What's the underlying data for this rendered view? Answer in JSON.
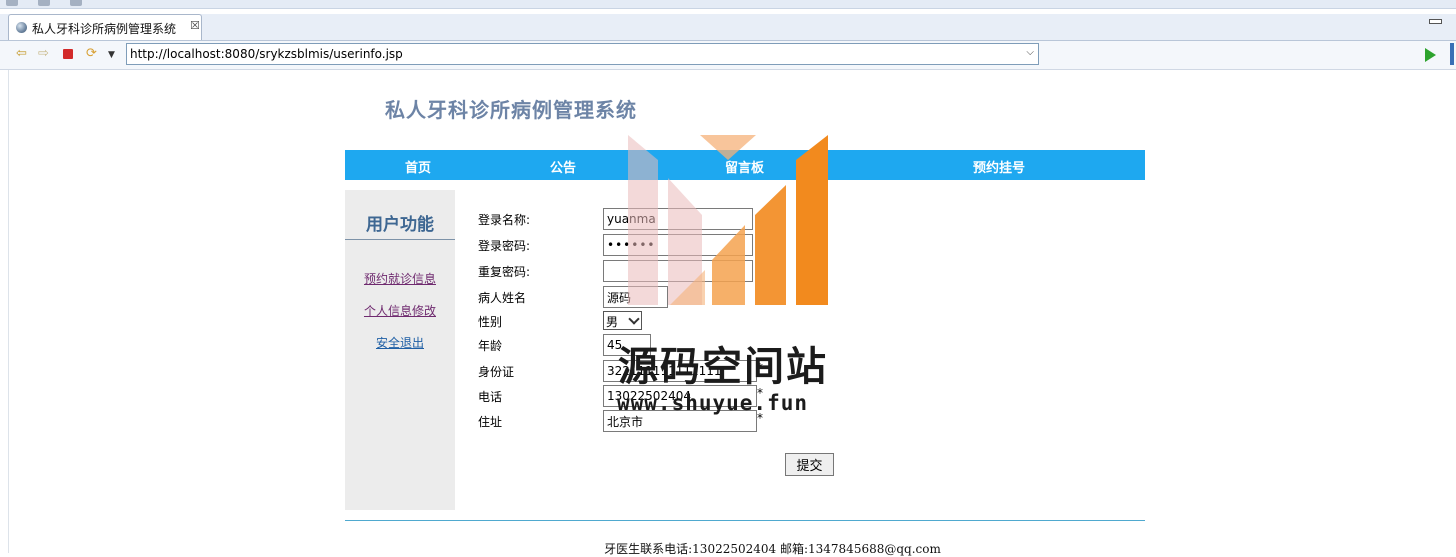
{
  "browser": {
    "tab_title": "私人牙科诊所病例管理系统",
    "tab_close": "☒",
    "url": "http://localhost:8080/srykzsblmis/userinfo.jsp"
  },
  "site": {
    "title": "私人牙科诊所病例管理系统",
    "nav": [
      "首页",
      "公告",
      "留言板",
      "预约挂号"
    ]
  },
  "sidebar": {
    "heading": "用户功能",
    "links": [
      "预约就诊信息",
      "个人信息修改",
      "安全退出"
    ]
  },
  "form": {
    "fields": [
      {
        "label": "登录名称:",
        "value": "yuanma"
      },
      {
        "label": "登录密码:",
        "value": "••••••"
      },
      {
        "label": "重复密码:",
        "value": ""
      },
      {
        "label": "病人姓名",
        "value": "源码"
      },
      {
        "label": "性别",
        "value": "男"
      },
      {
        "label": "年龄",
        "value": "45"
      },
      {
        "label": "身份证",
        "value": "322111111111111",
        "required": "*"
      },
      {
        "label": "电话",
        "value": "13022502404",
        "required": "*"
      },
      {
        "label": "住址",
        "value": "北京市",
        "required": "*"
      }
    ],
    "submit_label": "提交"
  },
  "footer": {
    "text": "牙医生联系电话:13022502404 邮箱:1347845688@qq.com"
  },
  "watermark": {
    "text": "源码空间站",
    "url": "www.shuyue.fun"
  },
  "colors": {
    "nav_bg": "#1ea8f0",
    "title": "#6d84a6",
    "sidebar_bg": "#ececec",
    "watermark_orange": "#f28a1e",
    "watermark_pink": "#e9b9b9"
  }
}
